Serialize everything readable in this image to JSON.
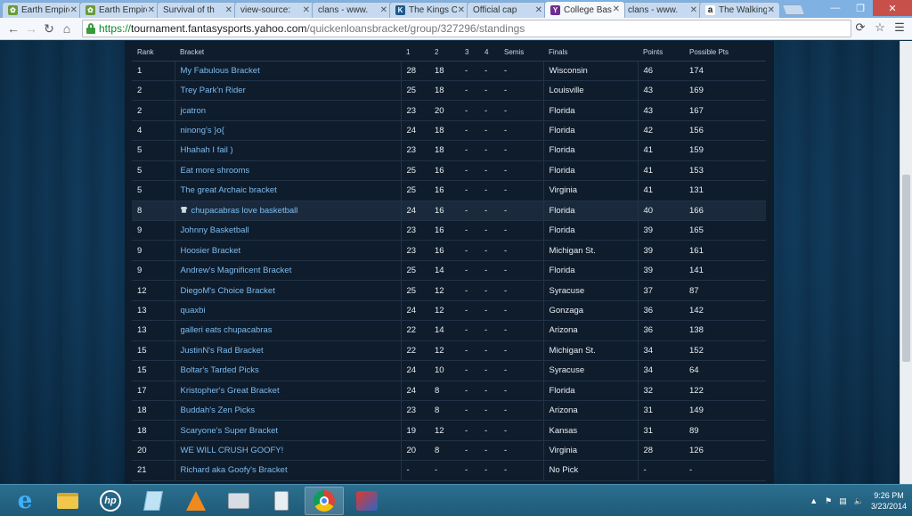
{
  "browser": {
    "tabs": [
      {
        "label": "Earth Empire",
        "icon": "globe-icon",
        "active": false
      },
      {
        "label": "Earth Empire",
        "icon": "globe-icon",
        "active": false
      },
      {
        "label": "Survival of th",
        "icon": "page-icon",
        "active": false
      },
      {
        "label": "view-source:",
        "icon": "page-icon",
        "active": false
      },
      {
        "label": "clans - www.",
        "icon": "page-icon",
        "active": false
      },
      {
        "label": "The Kings C",
        "icon": "kings-icon",
        "active": false
      },
      {
        "label": "Official cap",
        "icon": "page-icon",
        "active": false
      },
      {
        "label": "College Bask",
        "icon": "yahoo-icon",
        "active": true
      },
      {
        "label": "clans - www.",
        "icon": "page-icon",
        "active": false
      },
      {
        "label": "The Walking",
        "icon": "amazon-icon",
        "active": false
      }
    ],
    "url": {
      "protocol": "https://",
      "host": "tournament.fantasysports.yahoo.com",
      "path": "/quickenloansbracket/group/327296/standings"
    }
  },
  "standings": {
    "headers": {
      "rank": "Rank",
      "bracket": "Bracket",
      "r1": "1",
      "r2": "2",
      "r3": "3",
      "r4": "4",
      "semis": "Semis",
      "finals": "Finals",
      "points": "Points",
      "possible": "Possible Pts"
    },
    "rows": [
      {
        "rank": "1",
        "bracket": "My Fabulous Bracket",
        "r1": "28",
        "r2": "18",
        "r3": "-",
        "r4": "-",
        "semis": "-",
        "finals": "Wisconsin",
        "points": "46",
        "possible": "174"
      },
      {
        "rank": "2",
        "bracket": "Trey Park'n Rider",
        "r1": "25",
        "r2": "18",
        "r3": "-",
        "r4": "-",
        "semis": "-",
        "finals": "Louisville",
        "points": "43",
        "possible": "169"
      },
      {
        "rank": "2",
        "bracket": "jcatron",
        "r1": "23",
        "r2": "20",
        "r3": "-",
        "r4": "-",
        "semis": "-",
        "finals": "Florida",
        "points": "43",
        "possible": "167"
      },
      {
        "rank": "4",
        "bracket": "ninong's }o{",
        "r1": "24",
        "r2": "18",
        "r3": "-",
        "r4": "-",
        "semis": "-",
        "finals": "Florida",
        "points": "42",
        "possible": "156"
      },
      {
        "rank": "5",
        "bracket": "Hhahah I fail )",
        "r1": "23",
        "r2": "18",
        "r3": "-",
        "r4": "-",
        "semis": "-",
        "finals": "Florida",
        "points": "41",
        "possible": "159"
      },
      {
        "rank": "5",
        "bracket": "Eat more shrooms",
        "r1": "25",
        "r2": "16",
        "r3": "-",
        "r4": "-",
        "semis": "-",
        "finals": "Florida",
        "points": "41",
        "possible": "153"
      },
      {
        "rank": "5",
        "bracket": "The great Archaic bracket",
        "r1": "25",
        "r2": "16",
        "r3": "-",
        "r4": "-",
        "semis": "-",
        "finals": "Virginia",
        "points": "41",
        "possible": "131"
      },
      {
        "rank": "8",
        "bracket": "chupacabras love basketball",
        "r1": "24",
        "r2": "16",
        "r3": "-",
        "r4": "-",
        "semis": "-",
        "finals": "Florida",
        "points": "40",
        "possible": "166",
        "highlight": true,
        "icon": "shirt-icon"
      },
      {
        "rank": "9",
        "bracket": "Johnny Basketball",
        "r1": "23",
        "r2": "16",
        "r3": "-",
        "r4": "-",
        "semis": "-",
        "finals": "Florida",
        "points": "39",
        "possible": "165"
      },
      {
        "rank": "9",
        "bracket": "Hoosier Bracket",
        "r1": "23",
        "r2": "16",
        "r3": "-",
        "r4": "-",
        "semis": "-",
        "finals": "Michigan St.",
        "points": "39",
        "possible": "161"
      },
      {
        "rank": "9",
        "bracket": "Andrew's Magnificent Bracket",
        "r1": "25",
        "r2": "14",
        "r3": "-",
        "r4": "-",
        "semis": "-",
        "finals": "Florida",
        "points": "39",
        "possible": "141"
      },
      {
        "rank": "12",
        "bracket": "DiegoM's Choice Bracket",
        "r1": "25",
        "r2": "12",
        "r3": "-",
        "r4": "-",
        "semis": "-",
        "finals": "Syracuse",
        "points": "37",
        "possible": "87"
      },
      {
        "rank": "13",
        "bracket": "quaxbi",
        "r1": "24",
        "r2": "12",
        "r3": "-",
        "r4": "-",
        "semis": "-",
        "finals": "Gonzaga",
        "points": "36",
        "possible": "142"
      },
      {
        "rank": "13",
        "bracket": "galleri eats chupacabras",
        "r1": "22",
        "r2": "14",
        "r3": "-",
        "r4": "-",
        "semis": "-",
        "finals": "Arizona",
        "points": "36",
        "possible": "138"
      },
      {
        "rank": "15",
        "bracket": "JustinN's Rad Bracket",
        "r1": "22",
        "r2": "12",
        "r3": "-",
        "r4": "-",
        "semis": "-",
        "finals": "Michigan St.",
        "points": "34",
        "possible": "152"
      },
      {
        "rank": "15",
        "bracket": "Boltar's Tarded Picks",
        "r1": "24",
        "r2": "10",
        "r3": "-",
        "r4": "-",
        "semis": "-",
        "finals": "Syracuse",
        "points": "34",
        "possible": "64"
      },
      {
        "rank": "17",
        "bracket": "Kristopher's Great Bracket",
        "r1": "24",
        "r2": "8",
        "r3": "-",
        "r4": "-",
        "semis": "-",
        "finals": "Florida",
        "points": "32",
        "possible": "122"
      },
      {
        "rank": "18",
        "bracket": "Buddah's Zen Picks",
        "r1": "23",
        "r2": "8",
        "r3": "-",
        "r4": "-",
        "semis": "-",
        "finals": "Arizona",
        "points": "31",
        "possible": "149"
      },
      {
        "rank": "18",
        "bracket": "Scaryone's Super Bracket",
        "r1": "19",
        "r2": "12",
        "r3": "-",
        "r4": "-",
        "semis": "-",
        "finals": "Kansas",
        "points": "31",
        "possible": "89"
      },
      {
        "rank": "20",
        "bracket": "WE WILL CRUSH GOOFY!",
        "r1": "20",
        "r2": "8",
        "r3": "-",
        "r4": "-",
        "semis": "-",
        "finals": "Virginia",
        "points": "28",
        "possible": "126"
      },
      {
        "rank": "21",
        "bracket": "Richard aka Goofy's Bracket",
        "r1": "-",
        "r2": "-",
        "r3": "-",
        "r4": "-",
        "semis": "-",
        "finals": "No Pick",
        "points": "-",
        "possible": "-"
      }
    ]
  },
  "taskbar": {
    "apps": [
      {
        "name": "internet-explorer-icon",
        "active": false
      },
      {
        "name": "file-explorer-icon",
        "active": false
      },
      {
        "name": "hp-icon",
        "active": false
      },
      {
        "name": "notes-app-icon",
        "active": false
      },
      {
        "name": "vlc-icon",
        "active": false
      },
      {
        "name": "scanner-icon",
        "active": false
      },
      {
        "name": "calculator-icon",
        "active": false
      },
      {
        "name": "chrome-icon",
        "active": true
      },
      {
        "name": "game-app-icon",
        "active": false
      }
    ],
    "time": "9:26 PM",
    "date": "3/23/2014"
  },
  "colors": {
    "link": "#7dbcef",
    "panel": "#0e1c2c",
    "taskbar": "#2c6f8f"
  }
}
